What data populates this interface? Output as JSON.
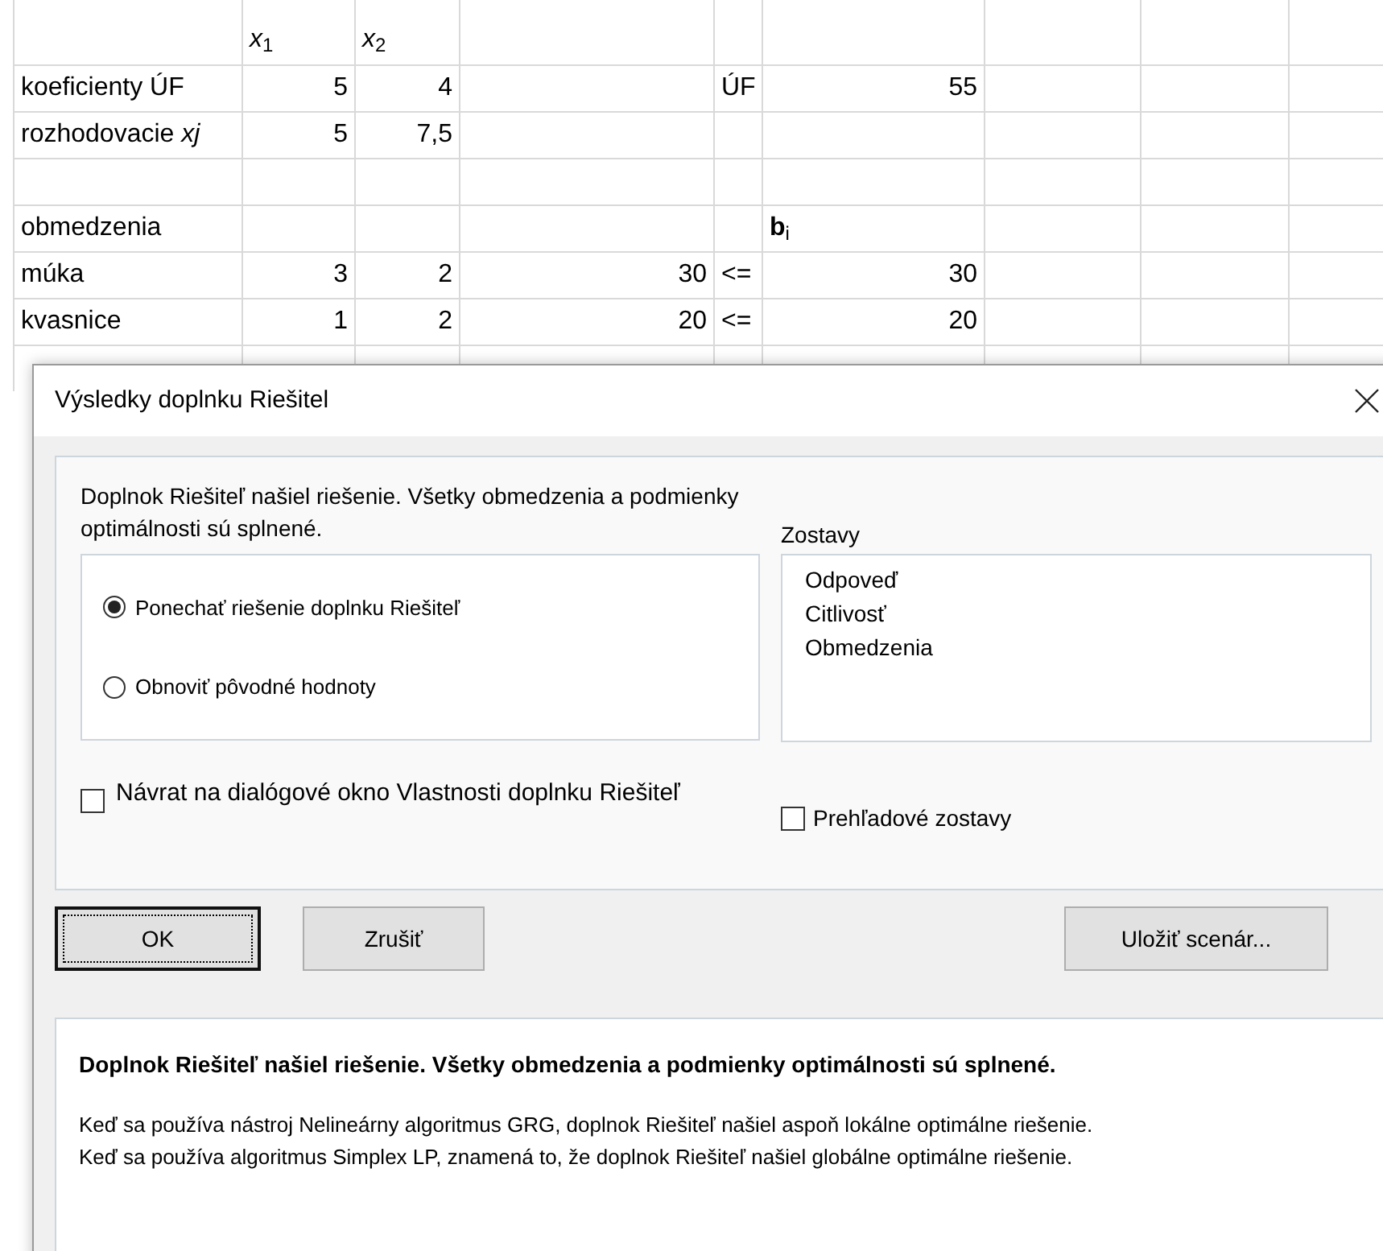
{
  "sheet": {
    "rows": [
      [
        null,
        {
          "text": "*x*$_{1}$",
          "kind": "label"
        },
        {
          "text": "*x*$_{2}$",
          "kind": "label"
        }
      ],
      [
        {
          "text": "koeficienty ÚF",
          "kind": "label"
        },
        {
          "text": "5",
          "kind": "number"
        },
        {
          "text": "4",
          "kind": "number"
        },
        null,
        {
          "text": "ÚF",
          "kind": "label"
        },
        {
          "text": "55",
          "kind": "number"
        }
      ],
      [
        {
          "text": "rozhodovacie *xj*",
          "kind": "label"
        },
        {
          "text": "5",
          "kind": "number"
        },
        {
          "text": "7,5",
          "kind": "number"
        }
      ],
      [],
      [
        {
          "text": "obmedzenia",
          "kind": "label"
        },
        null,
        null,
        null,
        null,
        {
          "text": "**b**$_{i}$",
          "kind": "label"
        }
      ],
      [
        {
          "text": "múka",
          "kind": "label"
        },
        {
          "text": "3",
          "kind": "number"
        },
        {
          "text": "2",
          "kind": "number"
        },
        {
          "text": "30",
          "kind": "number"
        },
        {
          "text": "<=",
          "kind": "label"
        },
        {
          "text": "30",
          "kind": "number"
        }
      ],
      [
        {
          "text": "kvasnice",
          "kind": "label"
        },
        {
          "text": "1",
          "kind": "number"
        },
        {
          "text": "2",
          "kind": "number"
        },
        {
          "text": "20",
          "kind": "number"
        },
        {
          "text": "<=",
          "kind": "label"
        },
        {
          "text": "20",
          "kind": "number"
        }
      ]
    ]
  },
  "dialog": {
    "title": "Výsledky doplnku Riešitel",
    "message": "Doplnok Riešiteľ našiel riešenie. Všetky obmedzenia a podmienky optimálnosti sú splnené.",
    "options": [
      {
        "label": "Ponechať riešenie doplnku Riešiteľ",
        "selected": true
      },
      {
        "label": "Obnoviť pôvodné hodnoty",
        "selected": false
      }
    ],
    "reports": {
      "label": "Zostavy",
      "items": [
        "Odpoveď",
        "Citlivosť",
        "Obmedzenia"
      ]
    },
    "return_checkbox": {
      "label": "Návrat na dialógové okno Vlastnosti doplnku Riešiteľ",
      "checked": false
    },
    "outline_checkbox": {
      "label": "Prehľadové zostavy",
      "checked": false
    },
    "buttons": [
      {
        "label": "OK",
        "default": true
      },
      {
        "label": "Zrušiť",
        "default": false
      },
      {
        "label": "Uložiť scenár...",
        "default": false
      }
    ],
    "details": {
      "headline": "Doplnok Riešiteľ našiel riešenie. Všetky obmedzenia a podmienky optimálnosti sú splnené.",
      "lines": [
        "Keď sa používa nástroj Nelineárny algoritmus GRG, doplnok Riešiteľ našiel aspoň lokálne optimálne riešenie.",
        "Keď sa používa algoritmus Simplex LP, znamená to, že doplnok Riešiteľ našiel globálne optimálne riešenie."
      ]
    }
  }
}
